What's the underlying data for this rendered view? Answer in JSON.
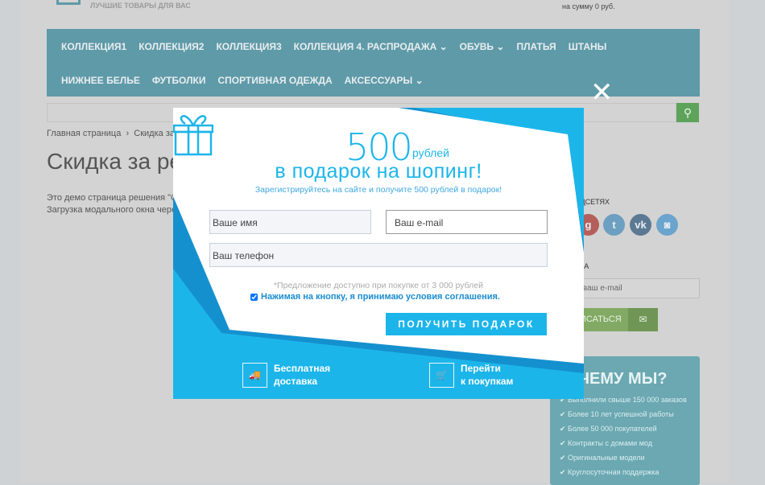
{
  "header": {
    "tagline": "ЛУЧШИЕ ТОВАРЫ ДЛЯ ВАС",
    "cart_sum": "на сумму 0 руб."
  },
  "nav": {
    "row1": [
      "КОЛЛЕКЦИЯ1",
      "КОЛЛЕКЦИЯ2",
      "КОЛЛЕКЦИЯ3",
      "КОЛЛЕКЦИЯ 4. РАСПРОДАЖА ⌄",
      "ОБУВЬ ⌄",
      "ПЛАТЬЯ",
      "ШТАНЫ"
    ],
    "row2": [
      "НИЖНЕЕ БЕЛЬЕ",
      "ФУТБОЛКИ",
      "СПОРТИВНАЯ ОДЕЖДА",
      "АКСЕССУАРЫ ⌄"
    ]
  },
  "breadcrumb": {
    "home": "Главная страница",
    "sep": "›",
    "current": "Скидка за ре"
  },
  "page": {
    "title": "Скидка за ре",
    "line1": "Это демо страница решения \"С",
    "line2": "Загрузка модального окна черех"
  },
  "sidebar": {
    "social_title": "ЦСЕТЯХ",
    "newsletter_title": "КА",
    "email_placeholder": "те ваш e-mail",
    "subscribe": "ИСАТЬСЯ",
    "why_title": "ЧЕМУ МЫ?",
    "why_items": [
      "Выполнили свыше 150 000 заказов",
      "Более 10 лет успешной работы",
      "Более 50 000 покупателей",
      "Контракты с домами мод",
      "Оригинальные модели",
      "Круглосуточная поддержка"
    ]
  },
  "modal": {
    "amount": "500",
    "currency": "рублей",
    "headline": "в подарок на шопинг!",
    "subtitle": "Зарегистрируйтесь на сайте и получите 500 рублей в подарок!",
    "name_placeholder": "Ваше имя",
    "email_placeholder": "Ваш e-mail",
    "phone_placeholder": "Ваш телефон",
    "note": "*Предложение доступно при покупке от 3 000 рублей",
    "agree": "Нажимая на кнопку, я принимаю условия соглашения.",
    "agree_checked": true,
    "submit": "ПОЛУЧИТЬ ПОДАРОК",
    "feature1": [
      "Бесплатная",
      "доставка"
    ],
    "feature2": [
      "Перейти",
      "к покупкам"
    ]
  },
  "colors": {
    "accent": "#1cb5ea",
    "accent_dark": "#1590cf",
    "nav": "#5f9aa8"
  }
}
